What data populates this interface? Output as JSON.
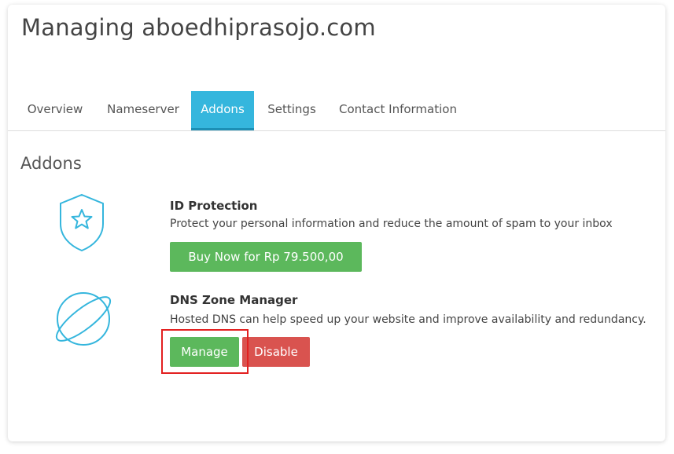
{
  "page": {
    "title": "Managing aboedhiprasojo.com"
  },
  "tabs": [
    {
      "label": "Overview",
      "active": false
    },
    {
      "label": "Nameserver",
      "active": false
    },
    {
      "label": "Addons",
      "active": true
    },
    {
      "label": "Settings",
      "active": false
    },
    {
      "label": "Contact Information",
      "active": false
    }
  ],
  "addons_section": {
    "title": "Addons",
    "items": [
      {
        "icon": "shield-star-icon",
        "name": "ID Protection",
        "description": "Protect your personal information and reduce the amount of spam to your inbox",
        "buttons": [
          {
            "label": "Buy Now for Rp 79.500,00",
            "color": "#5cb85c"
          }
        ]
      },
      {
        "icon": "planet-icon",
        "name": "DNS Zone Manager",
        "description": "Hosted DNS can help speed up your website and improve availability and redundancy.",
        "buttons": [
          {
            "label": "Manage",
            "color": "#5cb85c"
          },
          {
            "label": "Disable",
            "color": "#d9534f"
          }
        ]
      }
    ]
  },
  "colors": {
    "accent": "#35b6dd",
    "icon_stroke": "#35b6dd",
    "success": "#5cb85c",
    "danger": "#d9534f",
    "highlight": "#e32020"
  }
}
